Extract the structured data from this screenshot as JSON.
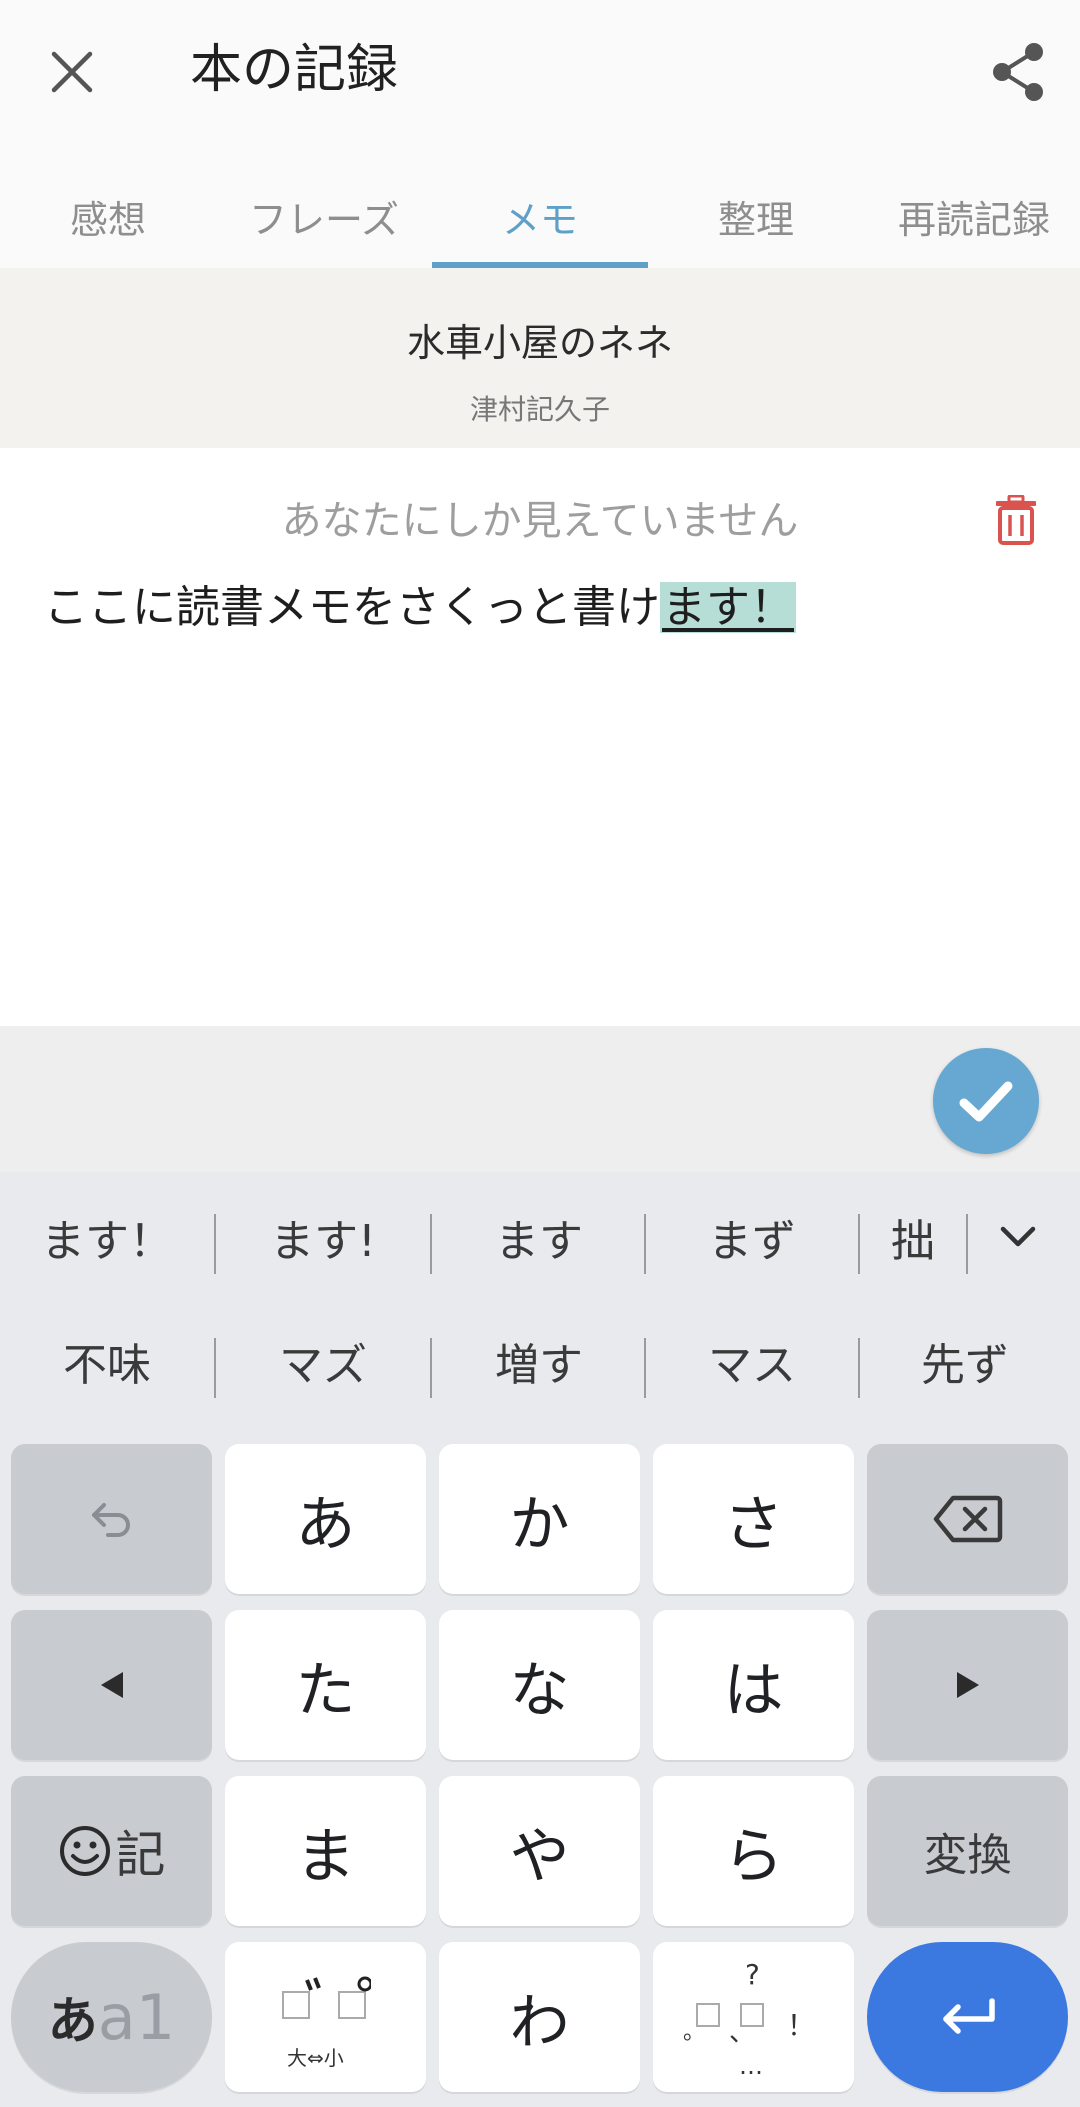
{
  "header": {
    "title": "本の記録",
    "close_icon": "close-icon",
    "share_icon": "share-icon"
  },
  "tabs": [
    {
      "label": "感想",
      "active": false
    },
    {
      "label": "フレーズ",
      "active": false
    },
    {
      "label": "メモ",
      "active": true
    },
    {
      "label": "整理",
      "active": false
    },
    {
      "label": "再読記録",
      "active": false
    }
  ],
  "book": {
    "title": "水車小屋のネネ",
    "author": "津村記久子"
  },
  "memo": {
    "privacy_notice": "あなたにしか見えていません",
    "text_committed": "ここに読書メモをさくっと書け",
    "text_composing": "ます！"
  },
  "colors": {
    "accent": "#5ea0c8",
    "delete": "#d9534f",
    "enter_key": "#3b78e0",
    "composing_highlight": "#b7ded6"
  },
  "keyboard": {
    "candidates_row1": [
      "ます！",
      "ます!",
      "ます",
      "まず",
      "拙"
    ],
    "candidates_row2": [
      "不味",
      "マズ",
      "増す",
      "マス",
      "先ず"
    ],
    "keys": {
      "a": "あ",
      "ka": "か",
      "sa": "さ",
      "ta": "た",
      "na": "な",
      "ha": "は",
      "ma": "ま",
      "ya": "や",
      "ra": "ら",
      "wa": "わ",
      "convert": "変換",
      "emoji_label": "記",
      "mode_label_kana": "あ",
      "mode_label_alpha": "a1",
      "dakuten_sub": "大⇔小",
      "punct_q": "?",
      "punct_comma": "、",
      "punct_period": "。",
      "punct_excl": "！",
      "punct_ellipsis": "…"
    }
  }
}
